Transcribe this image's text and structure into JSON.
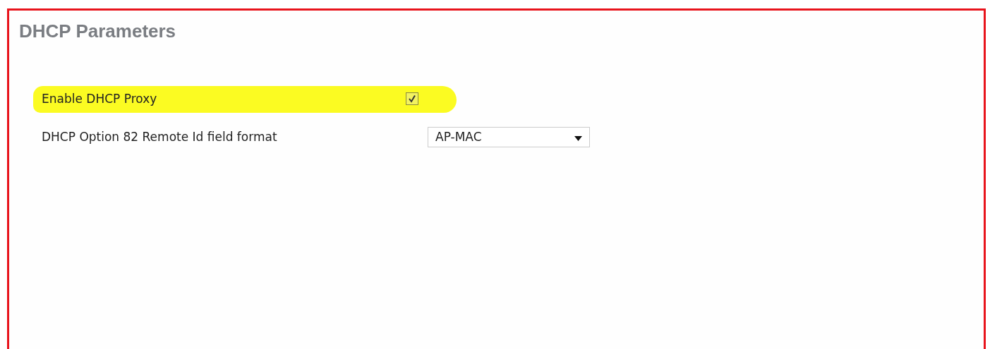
{
  "panel": {
    "title": "DHCP Parameters"
  },
  "rows": [
    {
      "kind": "checkbox",
      "label": "Enable DHCP Proxy",
      "checked": true,
      "highlighted": true
    },
    {
      "kind": "select",
      "label": "DHCP Option 82 Remote Id field format",
      "value": "AP-MAC",
      "highlighted": false
    }
  ]
}
